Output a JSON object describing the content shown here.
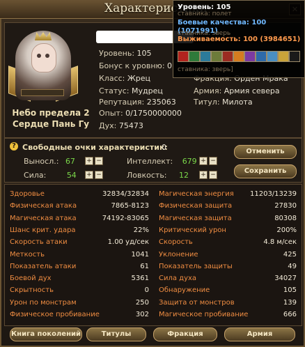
{
  "window": {
    "title": "Характеристики",
    "close_icon": "close-icon"
  },
  "character": {
    "nickname_line1": "Небо предела 2",
    "nickname_line2": "Сердце Пань Гу",
    "level_label": "Уровень:",
    "level": "105",
    "bonus_label": "Бонус к уровню:",
    "bonus": "0",
    "class_label": "Класс:",
    "class": "Жрец",
    "status_label": "Статус:",
    "status": "Мудрец",
    "reputation_label": "Репутация:",
    "reputation": "235063",
    "exp_label": "Опыт:",
    "exp": "0/1750000000",
    "spirit_label": "Дух:",
    "spirit": "75473",
    "faction_label": "Фракция:",
    "faction": "Орден Мрака",
    "army_label": "Армия:",
    "army": "Армия севера",
    "titul_label": "Титул:",
    "titul": "Милота",
    "exp_progress": 0.0
  },
  "free_points": {
    "label": "Свободные очки характеристик:",
    "value": "0",
    "stats": [
      {
        "label": "Выносл.:",
        "value": "67",
        "color": "#7bd84a"
      },
      {
        "label": "Сила:",
        "value": "54",
        "color": "#7bd84a"
      },
      {
        "label": "Интеллект:",
        "value": "679",
        "color": "#7bd84a"
      },
      {
        "label": "Ловкость:",
        "value": "12",
        "color": "#7bd84a"
      }
    ],
    "cancel_label": "Отменить",
    "save_label": "Сохранить",
    "plus_glyph": "+",
    "minus_glyph": "−"
  },
  "stats_left": [
    {
      "name": "Здоровье",
      "value": "32834/32834"
    },
    {
      "name": "Физическая атака",
      "value": "7865-8123"
    },
    {
      "name": "Магическая атака",
      "value": "74192-83065"
    },
    {
      "name": "Шанс крит. удара",
      "value": "22%"
    },
    {
      "name": "Скорость атаки",
      "value": "1.00 уд/сек"
    },
    {
      "name": "Меткость",
      "value": "1041"
    },
    {
      "name": "Показатель атаки",
      "value": "61"
    },
    {
      "name": "Боевой дух",
      "value": "5361"
    },
    {
      "name": "Скрытность",
      "value": "0"
    },
    {
      "name": "Урон по монстрам",
      "value": "250"
    },
    {
      "name": "Физическое пробивание",
      "value": "302"
    }
  ],
  "stats_right": [
    {
      "name": "Магическая энергия",
      "value": "11203/13239"
    },
    {
      "name": "Физическая защита",
      "value": "27830"
    },
    {
      "name": "Магическая защита",
      "value": "80308"
    },
    {
      "name": "Критический урон",
      "value": "200%"
    },
    {
      "name": "Скорость",
      "value": "4.8 м/сек"
    },
    {
      "name": "Уклонение",
      "value": "425"
    },
    {
      "name": "Показатель защиты",
      "value": "49"
    },
    {
      "name": "Сила духа",
      "value": "34027"
    },
    {
      "name": "Обнаружение",
      "value": "105"
    },
    {
      "name": "Защита от монстров",
      "value": "139"
    },
    {
      "name": "Магическое пробивание",
      "value": "666"
    }
  ],
  "bottom_buttons": [
    "Книга поколений",
    "Титулы",
    "Фракция",
    "Армия"
  ],
  "tooltip": {
    "level_label": "Уровень:",
    "level": "105",
    "combat_label": "Боевые качества:",
    "combat": "100 (1071991)",
    "survival_label": "Выживаемость:",
    "survival": "100 (3984651)",
    "hint_top": "ставника: полет",
    "hint_mid": "ставника: зверь",
    "hint_bottom": "ставника: зверь]"
  },
  "colors": {
    "stat_name": "#f08d42",
    "tooltip_combat": "#6fb8ff",
    "tooltip_survival": "#ff9a4d"
  }
}
